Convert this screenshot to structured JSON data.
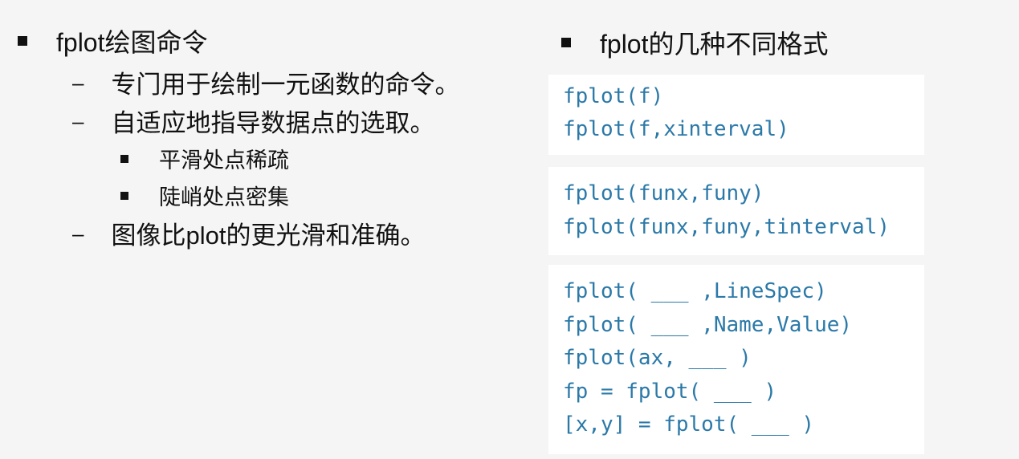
{
  "left": {
    "heading": "fplot绘图命令",
    "items": [
      "专门用于绘制一元函数的命令。",
      "自适应地指导数据点的选取。",
      "图像比plot的更光滑和准确。"
    ],
    "subitems": [
      "平滑处点稀疏",
      "陡峭处点密集"
    ]
  },
  "right": {
    "heading": "fplot的几种不同格式",
    "box1": [
      "fplot(f)",
      "fplot(f,xinterval)"
    ],
    "box2": [
      "fplot(funx,funy)",
      "fplot(funx,funy,tinterval)"
    ],
    "box3": [
      "fplot( ___ ,LineSpec)",
      "fplot( ___ ,Name,Value)",
      "fplot(ax, ___ )",
      "fp = fplot( ___ )",
      "[x,y] = fplot( ___ )"
    ]
  },
  "colors": {
    "code": "#2b79a8",
    "text": "#111111",
    "background": "#f5f5f5",
    "code_box": "#ffffff"
  }
}
